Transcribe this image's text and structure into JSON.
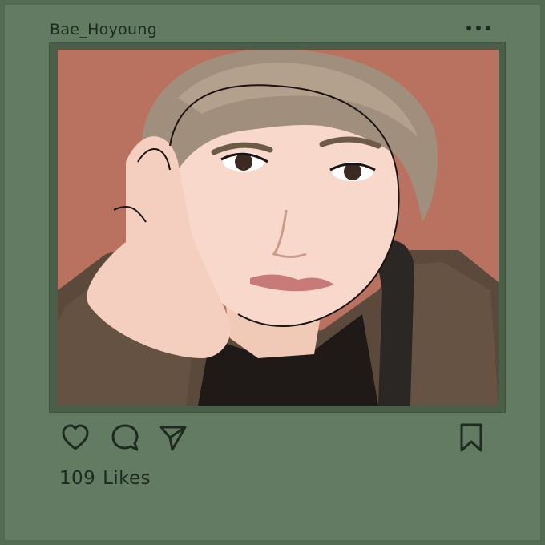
{
  "post": {
    "username": "Bae_Hoyoung",
    "likes_count": "109",
    "likes_label": "Likes"
  },
  "icons": {
    "more": "more-dots-icon",
    "like": "heart-icon",
    "comment": "comment-bubble-icon",
    "share": "paper-plane-icon",
    "save": "bookmark-icon"
  },
  "colors": {
    "background": "#647b63",
    "border": "#536a53",
    "photo_frame": "#4a5e49",
    "photo_background": "#b9725f",
    "text": "#1f2a20"
  }
}
